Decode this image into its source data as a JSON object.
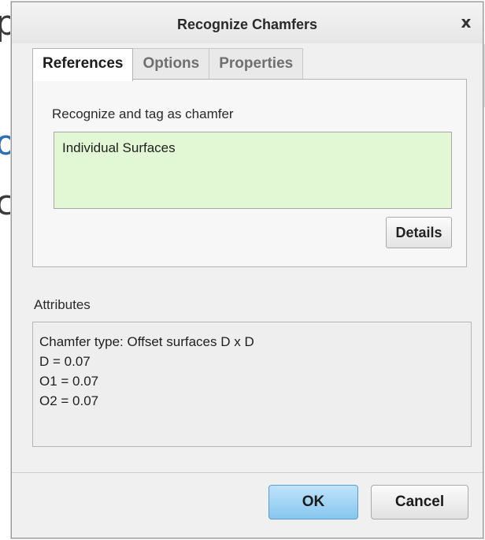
{
  "background": {
    "letters": [
      "p",
      "o",
      "c"
    ]
  },
  "dialog": {
    "title": "Recognize Chamfers",
    "close_label": "x"
  },
  "tabs": [
    {
      "label": "References",
      "active": true
    },
    {
      "label": "Options",
      "active": false
    },
    {
      "label": "Properties",
      "active": false
    }
  ],
  "references": {
    "label": "Recognize and tag as chamfer",
    "selection": "Individual Surfaces",
    "details_label": "Details"
  },
  "attributes": {
    "label": "Attributes",
    "lines": [
      "Chamfer type: Offset surfaces D x D",
      "D = 0.07",
      "O1 = 0.07",
      "O2 = 0.07"
    ]
  },
  "footer": {
    "ok_label": "OK",
    "cancel_label": "Cancel"
  },
  "colors": {
    "selection_background": "#e2f7d4",
    "primary_button": "#86c6ef",
    "link_blue": "#2b6fb6"
  }
}
